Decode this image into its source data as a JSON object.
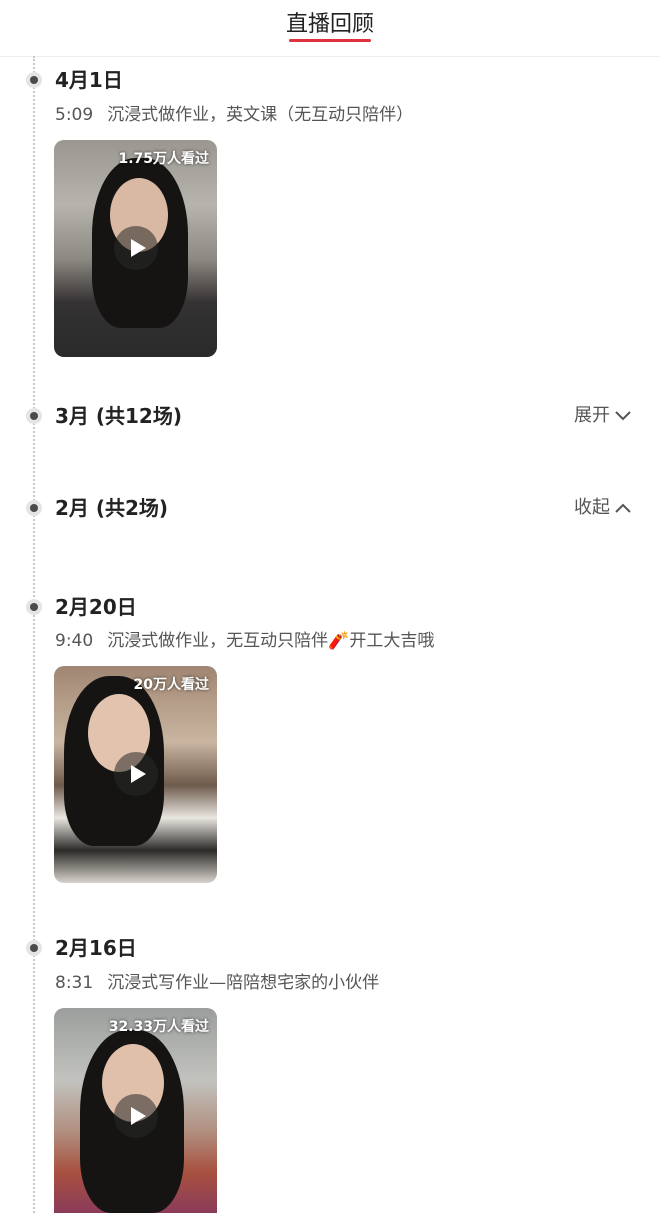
{
  "header": {
    "title": "直播回顾"
  },
  "entries": [
    {
      "date": "4月1日",
      "time": "5:09",
      "title": "沉浸式做作业，英文课（无互动只陪伴）",
      "viewers": "1.75万人看过"
    },
    {
      "date": "2月20日",
      "time": "9:40",
      "title": "沉浸式做作业，无互动只陪伴🧨开工大吉哦",
      "viewers": "20万人看过"
    },
    {
      "date": "2月16日",
      "time": "8:31",
      "title": "沉浸式写作业—陪陪想宅家的小伙伴",
      "viewers": "32.33万人看过"
    }
  ],
  "months": [
    {
      "title": "3月 (共12场)",
      "toggle_label": "展开",
      "toggle_icon": "chevron-down-icon"
    },
    {
      "title": "2月 (共2场)",
      "toggle_label": "收起",
      "toggle_icon": "chevron-up-icon"
    }
  ],
  "colors": {
    "accent": "#e0323c",
    "timeline": "#c8c8c8"
  }
}
